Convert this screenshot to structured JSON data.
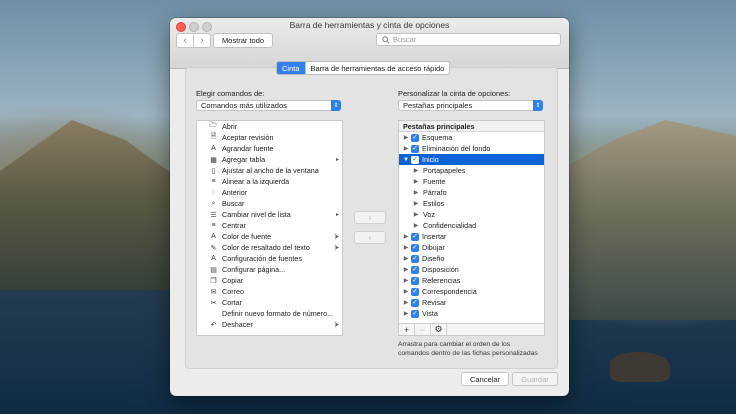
{
  "window": {
    "title": "Barra de herramientas y cinta de opciones"
  },
  "toolbar": {
    "back": "‹",
    "forward": "›",
    "show_all": "Mostrar todo",
    "search_placeholder": "Buscar"
  },
  "tabs": [
    {
      "label": "Cinta",
      "active": true
    },
    {
      "label": "Barra de herramientas de acceso rápido",
      "active": false
    }
  ],
  "left": {
    "label": "Elegir comandos de:",
    "select_value": "Comandos más utilizados",
    "commands": [
      {
        "label": "Abrir",
        "icon": "folder-icon",
        "glyph": "🗁"
      },
      {
        "label": "Aceptar revisión",
        "icon": "accept-revision-icon",
        "glyph": "🗎"
      },
      {
        "label": "Agrandar fuente",
        "icon": "grow-font-icon",
        "glyph": "A"
      },
      {
        "label": "Agregar tabla",
        "icon": "table-icon",
        "glyph": "▦",
        "submenu": "▸"
      },
      {
        "label": "Ajustar al ancho de la ventana",
        "icon": "page-width-icon",
        "glyph": "▯"
      },
      {
        "label": "Alinear a la izquierda",
        "icon": "align-left-icon",
        "glyph": "≡"
      },
      {
        "label": "Anterior",
        "icon": "previous-comment-icon",
        "glyph": "◌"
      },
      {
        "label": "Buscar",
        "icon": "search-icon",
        "glyph": "⌕"
      },
      {
        "label": "Cambiar nivel de lista",
        "icon": "list-level-icon",
        "glyph": "☰",
        "submenu": "▸"
      },
      {
        "label": "Centrar",
        "icon": "align-center-icon",
        "glyph": "≡"
      },
      {
        "label": "Color de fuente",
        "icon": "font-color-icon",
        "glyph": "A",
        "submenu": "|▸"
      },
      {
        "label": "Color de resaltado del texto",
        "icon": "highlighter-icon",
        "glyph": "✎",
        "submenu": "|▸"
      },
      {
        "label": "Configuración de fuentes",
        "icon": "font-settings-icon",
        "glyph": "A"
      },
      {
        "label": "Configurar página...",
        "icon": "page-setup-icon",
        "glyph": "▤"
      },
      {
        "label": "Copiar",
        "icon": "copy-icon",
        "glyph": "❐"
      },
      {
        "label": "Correo",
        "icon": "mail-icon",
        "glyph": "✉"
      },
      {
        "label": "Cortar",
        "icon": "scissors-icon",
        "glyph": "✂"
      },
      {
        "label": "Definir nuevo formato de número...",
        "icon": "number-format-icon",
        "glyph": ""
      },
      {
        "label": "Deshacer",
        "icon": "undo-icon",
        "glyph": "↶",
        "submenu": "|▸"
      }
    ]
  },
  "middle": {
    "add": "›",
    "remove": "‹"
  },
  "right": {
    "label": "Personalizar la cinta de opciones:",
    "select_value": "Pestañas principales",
    "header": "Pestañas principales",
    "tabs": [
      {
        "label": "Esquema",
        "level": 0,
        "disclosure": "▶",
        "checked": true
      },
      {
        "label": "Eliminación del fondo",
        "level": 0,
        "disclosure": "▶",
        "checked": true
      },
      {
        "label": "Inicio",
        "level": 0,
        "disclosure": "▼",
        "checked": true,
        "selected": true
      },
      {
        "label": "Portapapeles",
        "level": 1,
        "disclosure": "▶"
      },
      {
        "label": "Fuente",
        "level": 1,
        "disclosure": "▶"
      },
      {
        "label": "Párrafo",
        "level": 1,
        "disclosure": "▶"
      },
      {
        "label": "Estilos",
        "level": 1,
        "disclosure": "▶"
      },
      {
        "label": "Voz",
        "level": 1,
        "disclosure": "▶"
      },
      {
        "label": "Confidencialidad",
        "level": 1,
        "disclosure": "▶"
      },
      {
        "label": "Insertar",
        "level": 0,
        "disclosure": "▶",
        "checked": true
      },
      {
        "label": "Dibujar",
        "level": 0,
        "disclosure": "▶",
        "checked": true
      },
      {
        "label": "Diseño",
        "level": 0,
        "disclosure": "▶",
        "checked": true
      },
      {
        "label": "Disposición",
        "level": 0,
        "disclosure": "▶",
        "checked": true
      },
      {
        "label": "Referencias",
        "level": 0,
        "disclosure": "▶",
        "checked": true
      },
      {
        "label": "Correspondencia",
        "level": 0,
        "disclosure": "▶",
        "checked": true
      },
      {
        "label": "Revisar",
        "level": 0,
        "disclosure": "▶",
        "checked": true
      },
      {
        "label": "Vista",
        "level": 0,
        "disclosure": "▶",
        "checked": true
      }
    ],
    "add": "+",
    "remove": "−",
    "settings": "⚙",
    "hint_line1": "Arrastra para cambiar el orden de los",
    "hint_line2": "comandos dentro de las fichas personalizadas"
  },
  "footer": {
    "cancel": "Cancelar",
    "save": "Guardar"
  },
  "colors": {
    "accent": "#2f80ed",
    "selection": "#0a64d8"
  }
}
